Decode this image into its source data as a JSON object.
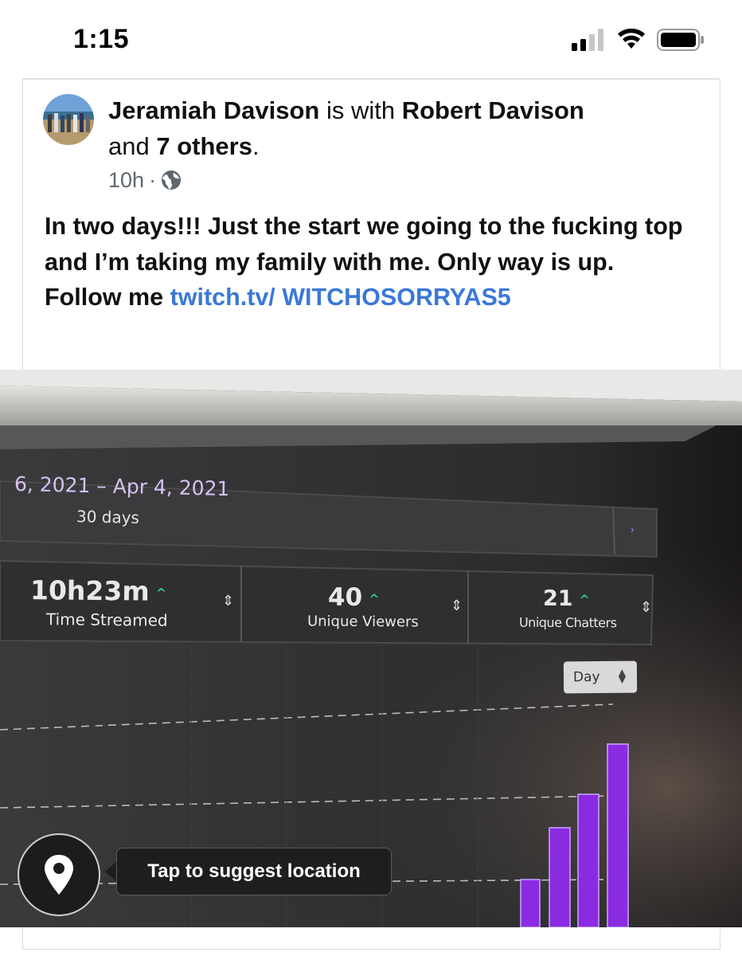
{
  "status_bar": {
    "time": "1:15",
    "signal_icon": "cellular-signal-icon",
    "wifi_icon": "wifi-icon",
    "battery_icon": "battery-icon"
  },
  "post": {
    "author": "Jeramiah Davison",
    "with_text": " is with ",
    "tagged": "Robert Davison",
    "and_text": "and ",
    "others": "7 others",
    "period": ".",
    "time_ago": "10h",
    "separator": "·",
    "privacy_icon": "globe-icon",
    "body_text": "In two days!!! Just the start we going to the fucking top and I’m taking my family with me. Only way is up. Follow me ",
    "link_text": "twitch.tv/ WITCHOSORRYAS5"
  },
  "photo": {
    "date_range": "6, 2021 – Apr 4, 2021",
    "days": "30 days",
    "stats": [
      {
        "value": "10h23m",
        "label": "Time Streamed"
      },
      {
        "value": "40",
        "label": "Unique Viewers"
      },
      {
        "value": "21",
        "label": "Unique Chatters"
      }
    ],
    "up_glyph": "^",
    "sort_glyph": "⇕",
    "granularity": "Day",
    "next_glyph": "›",
    "bar_color": "#8a2be2"
  },
  "location": {
    "icon": "map-pin-icon",
    "tooltip": "Tap to suggest location"
  }
}
